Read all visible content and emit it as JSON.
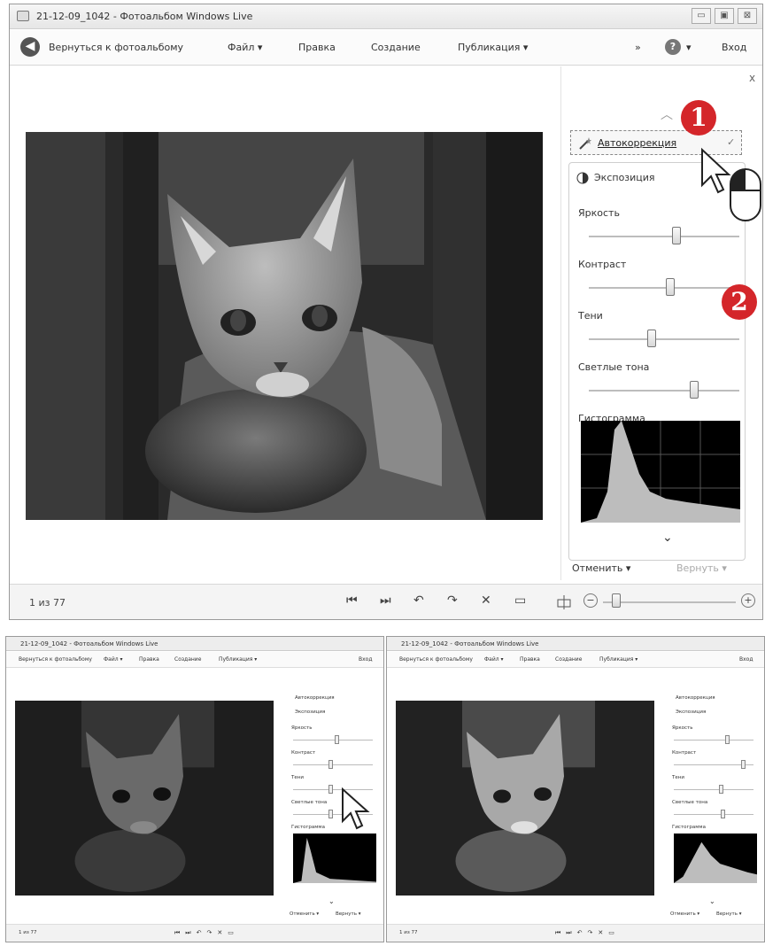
{
  "main": {
    "title": "21-12-09_1042 - Фотоальбом Windows Live",
    "window_buttons": [
      "▭",
      "▣",
      "⊠"
    ],
    "menu": {
      "back_label": "Вернуться к фотоальбому",
      "file": "Файл ▾",
      "edit": "Правка",
      "create": "Создание",
      "publish": "Публикация ▾",
      "more": "»",
      "help": "?",
      "help_arrow": "▾",
      "signin": "Вход"
    },
    "panel": {
      "close": "x",
      "up_arrow": "︿",
      "autocorrect": "Автокоррекция",
      "check": "✓",
      "exposure": "Экспозиция",
      "brightness": "Яркость",
      "contrast": "Контраст",
      "shadows": "Тени",
      "highlights": "Светлые тона",
      "histogram": "Гистограмма",
      "down_arrow": "⌄",
      "undo": "Отменить ▾",
      "redo": "Вернуть ▾"
    },
    "sliders": {
      "brightness": 0.58,
      "contrast": 0.54,
      "shadows": 0.42,
      "highlights": 0.7
    },
    "status": {
      "counter": "1 из 77",
      "controls": [
        "⏮",
        "⏭",
        "↶",
        "↷",
        "✕",
        "▭"
      ],
      "zoom_minus": "−",
      "zoom_plus": "+",
      "zoom": 0.1
    },
    "callouts": [
      "1",
      "2"
    ]
  },
  "small_left": {
    "title": "21-12-09_1042 - Фотоальбом Windows Live",
    "menu": [
      "Вернуться к фотоальбому",
      "Файл ▾",
      "Правка",
      "Создание",
      "Публикация ▾",
      "Вход"
    ],
    "panel": [
      "Автокоррекция",
      "Экспозиция",
      "Яркость",
      "Контраст",
      "Тени",
      "Светлые тона",
      "Гистограмма"
    ],
    "undo": "Отменить ▾",
    "redo": "Вернуть ▾",
    "counter": "1 из 77",
    "sliders": {
      "brightness": 0.55,
      "contrast": 0.48,
      "shadows": 0.48,
      "highlights": 0.48
    }
  },
  "small_right": {
    "title": "21-12-09_1042 - Фотоальбом Windows Live",
    "menu": [
      "Вернуться к фотоальбому",
      "Файл ▾",
      "Правка",
      "Создание",
      "Публикация ▾",
      "Вход"
    ],
    "panel": [
      "Автокоррекция",
      "Экспозиция",
      "Яркость",
      "Контраст",
      "Тени",
      "Светлые тона",
      "Гистограмма"
    ],
    "undo": "Отменить ▾",
    "redo": "Вернуть ▾",
    "counter": "1 из 77",
    "sliders": {
      "brightness": 0.68,
      "contrast": 0.88,
      "shadows": 0.6,
      "highlights": 0.62
    }
  }
}
